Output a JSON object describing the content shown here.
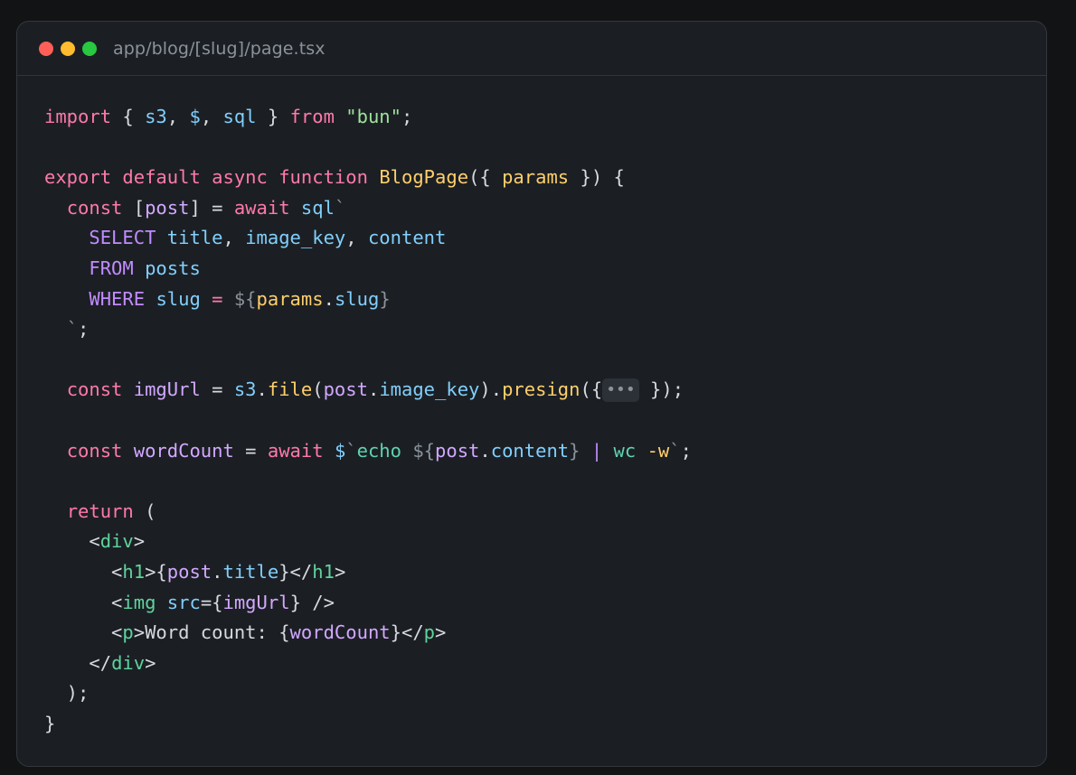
{
  "window": {
    "title": "app/blog/[slug]/page.tsx",
    "traffic_lights": [
      {
        "name": "close",
        "color": "#ff5f57"
      },
      {
        "name": "minimize",
        "color": "#febc2e"
      },
      {
        "name": "maximize",
        "color": "#28c840"
      }
    ]
  },
  "code": {
    "lines": [
      [
        {
          "t": "kw",
          "v": "import"
        },
        {
          "t": "punct",
          "v": " { "
        },
        {
          "t": "ident",
          "v": "s3"
        },
        {
          "t": "punct",
          "v": ", "
        },
        {
          "t": "ident",
          "v": "$"
        },
        {
          "t": "punct",
          "v": ", "
        },
        {
          "t": "ident",
          "v": "sql"
        },
        {
          "t": "punct",
          "v": " } "
        },
        {
          "t": "kw",
          "v": "from"
        },
        {
          "t": "punct",
          "v": " "
        },
        {
          "t": "str",
          "v": "\"bun\""
        },
        {
          "t": "punct",
          "v": ";"
        }
      ],
      [],
      [
        {
          "t": "kw",
          "v": "export"
        },
        {
          "t": "punct",
          "v": " "
        },
        {
          "t": "kw",
          "v": "default"
        },
        {
          "t": "punct",
          "v": " "
        },
        {
          "t": "kw",
          "v": "async"
        },
        {
          "t": "punct",
          "v": " "
        },
        {
          "t": "kw",
          "v": "function"
        },
        {
          "t": "punct",
          "v": " "
        },
        {
          "t": "fn",
          "v": "BlogPage"
        },
        {
          "t": "punct",
          "v": "({ "
        },
        {
          "t": "param",
          "v": "params"
        },
        {
          "t": "punct",
          "v": " }) {"
        }
      ],
      [
        {
          "t": "punct",
          "v": "  "
        },
        {
          "t": "kw",
          "v": "const"
        },
        {
          "t": "punct",
          "v": " ["
        },
        {
          "t": "prop",
          "v": "post"
        },
        {
          "t": "punct",
          "v": "] = "
        },
        {
          "t": "kw",
          "v": "await"
        },
        {
          "t": "punct",
          "v": " "
        },
        {
          "t": "ident",
          "v": "sql"
        },
        {
          "t": "interp",
          "v": "`"
        }
      ],
      [
        {
          "t": "punct",
          "v": "    "
        },
        {
          "t": "sql",
          "v": "SELECT"
        },
        {
          "t": "punct",
          "v": " "
        },
        {
          "t": "ident",
          "v": "title"
        },
        {
          "t": "punct",
          "v": ", "
        },
        {
          "t": "ident",
          "v": "image_key"
        },
        {
          "t": "punct",
          "v": ", "
        },
        {
          "t": "ident",
          "v": "content"
        }
      ],
      [
        {
          "t": "punct",
          "v": "    "
        },
        {
          "t": "sql",
          "v": "FROM"
        },
        {
          "t": "punct",
          "v": " "
        },
        {
          "t": "ident",
          "v": "posts"
        }
      ],
      [
        {
          "t": "punct",
          "v": "    "
        },
        {
          "t": "sql",
          "v": "WHERE"
        },
        {
          "t": "punct",
          "v": " "
        },
        {
          "t": "ident",
          "v": "slug"
        },
        {
          "t": "punct",
          "v": " "
        },
        {
          "t": "kw",
          "v": "="
        },
        {
          "t": "punct",
          "v": " "
        },
        {
          "t": "interp",
          "v": "${"
        },
        {
          "t": "param",
          "v": "params"
        },
        {
          "t": "punct",
          "v": "."
        },
        {
          "t": "ident",
          "v": "slug"
        },
        {
          "t": "interp",
          "v": "}"
        }
      ],
      [
        {
          "t": "punct",
          "v": "  "
        },
        {
          "t": "interp",
          "v": "`"
        },
        {
          "t": "punct",
          "v": ";"
        }
      ],
      [],
      [
        {
          "t": "punct",
          "v": "  "
        },
        {
          "t": "kw",
          "v": "const"
        },
        {
          "t": "punct",
          "v": " "
        },
        {
          "t": "prop",
          "v": "imgUrl"
        },
        {
          "t": "punct",
          "v": " = "
        },
        {
          "t": "ident",
          "v": "s3"
        },
        {
          "t": "punct",
          "v": "."
        },
        {
          "t": "fn",
          "v": "file"
        },
        {
          "t": "punct",
          "v": "("
        },
        {
          "t": "prop",
          "v": "post"
        },
        {
          "t": "punct",
          "v": "."
        },
        {
          "t": "ident",
          "v": "image_key"
        },
        {
          "t": "punct",
          "v": ")."
        },
        {
          "t": "fn",
          "v": "presign"
        },
        {
          "t": "punct",
          "v": "({"
        },
        {
          "t": "fold",
          "v": "•••"
        },
        {
          "t": "punct",
          "v": " });"
        }
      ],
      [],
      [
        {
          "t": "punct",
          "v": "  "
        },
        {
          "t": "kw",
          "v": "const"
        },
        {
          "t": "punct",
          "v": " "
        },
        {
          "t": "prop",
          "v": "wordCount"
        },
        {
          "t": "punct",
          "v": " = "
        },
        {
          "t": "kw",
          "v": "await"
        },
        {
          "t": "punct",
          "v": " "
        },
        {
          "t": "ident",
          "v": "$"
        },
        {
          "t": "interp",
          "v": "`"
        },
        {
          "t": "shell",
          "v": "echo"
        },
        {
          "t": "punct",
          "v": " "
        },
        {
          "t": "interp",
          "v": "${"
        },
        {
          "t": "prop",
          "v": "post"
        },
        {
          "t": "punct",
          "v": "."
        },
        {
          "t": "ident",
          "v": "content"
        },
        {
          "t": "interp",
          "v": "}"
        },
        {
          "t": "punct",
          "v": " "
        },
        {
          "t": "sql",
          "v": "|"
        },
        {
          "t": "punct",
          "v": " "
        },
        {
          "t": "shell",
          "v": "wc"
        },
        {
          "t": "punct",
          "v": " "
        },
        {
          "t": "flag",
          "v": "-w"
        },
        {
          "t": "interp",
          "v": "`"
        },
        {
          "t": "punct",
          "v": ";"
        }
      ],
      [],
      [
        {
          "t": "punct",
          "v": "  "
        },
        {
          "t": "kw",
          "v": "return"
        },
        {
          "t": "punct",
          "v": " ("
        }
      ],
      [
        {
          "t": "punct",
          "v": "    <"
        },
        {
          "t": "tag",
          "v": "div"
        },
        {
          "t": "punct",
          "v": ">"
        }
      ],
      [
        {
          "t": "punct",
          "v": "      <"
        },
        {
          "t": "tag",
          "v": "h1"
        },
        {
          "t": "punct",
          "v": ">{"
        },
        {
          "t": "prop",
          "v": "post"
        },
        {
          "t": "punct",
          "v": "."
        },
        {
          "t": "ident",
          "v": "title"
        },
        {
          "t": "punct",
          "v": "}</"
        },
        {
          "t": "tag",
          "v": "h1"
        },
        {
          "t": "punct",
          "v": ">"
        }
      ],
      [
        {
          "t": "punct",
          "v": "      <"
        },
        {
          "t": "tag",
          "v": "img"
        },
        {
          "t": "punct",
          "v": " "
        },
        {
          "t": "attr",
          "v": "src"
        },
        {
          "t": "punct",
          "v": "={"
        },
        {
          "t": "prop",
          "v": "imgUrl"
        },
        {
          "t": "punct",
          "v": "} />"
        }
      ],
      [
        {
          "t": "punct",
          "v": "      <"
        },
        {
          "t": "tag",
          "v": "p"
        },
        {
          "t": "punct",
          "v": ">"
        },
        {
          "t": "text",
          "v": "Word count: "
        },
        {
          "t": "punct",
          "v": "{"
        },
        {
          "t": "prop",
          "v": "wordCount"
        },
        {
          "t": "punct",
          "v": "}</"
        },
        {
          "t": "tag",
          "v": "p"
        },
        {
          "t": "punct",
          "v": ">"
        }
      ],
      [
        {
          "t": "punct",
          "v": "    </"
        },
        {
          "t": "tag",
          "v": "div"
        },
        {
          "t": "punct",
          "v": ">"
        }
      ],
      [
        {
          "t": "punct",
          "v": "  );"
        }
      ],
      [
        {
          "t": "punct",
          "v": "}"
        }
      ]
    ]
  }
}
